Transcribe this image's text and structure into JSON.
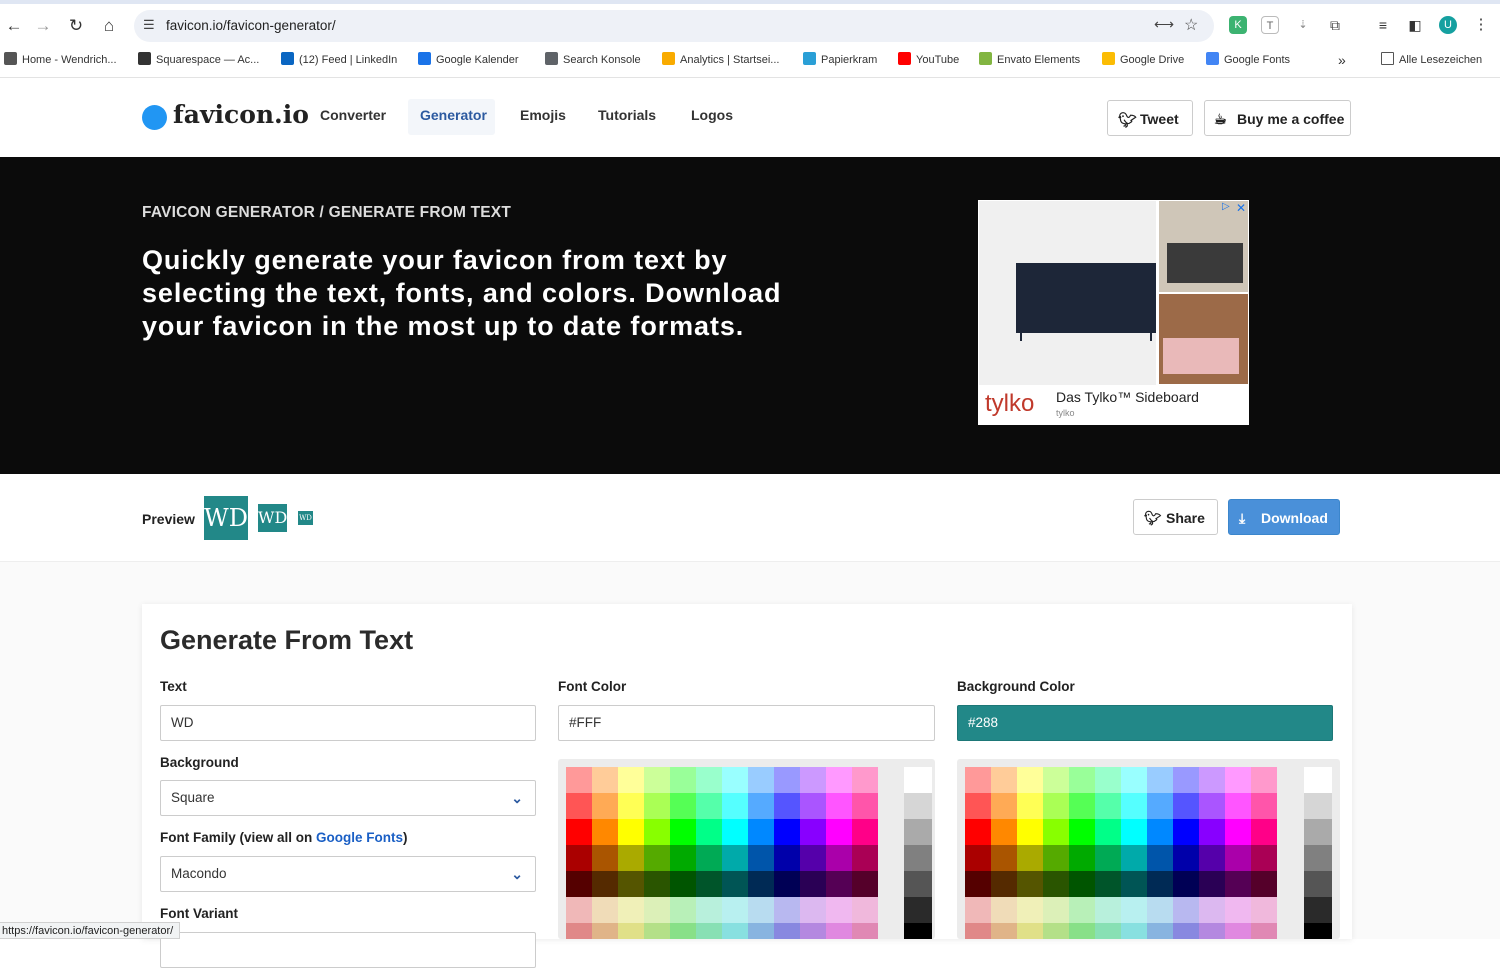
{
  "browser": {
    "url": "favicon.io/favicon-generator/",
    "status_url": "https://favicon.io/favicon-generator/",
    "bookmarks": [
      {
        "label": "Home - Wendrich...",
        "icon": "wd-icon",
        "color": "#555555"
      },
      {
        "label": "Squarespace — Ac...",
        "icon": "squarespace-icon",
        "color": "#333333"
      },
      {
        "label": "(12) Feed | LinkedIn",
        "icon": "linkedin-icon",
        "color": "#0a66c2"
      },
      {
        "label": "Google Kalender",
        "icon": "calendar-icon",
        "color": "#1a73e8"
      },
      {
        "label": "Search Konsole",
        "icon": "search-console-icon",
        "color": "#5f6368"
      },
      {
        "label": "Analytics | Startsei...",
        "icon": "analytics-icon",
        "color": "#f9ab00"
      },
      {
        "label": "Papierkram",
        "icon": "papierkram-icon",
        "color": "#2a9fd6"
      },
      {
        "label": "YouTube",
        "icon": "youtube-icon",
        "color": "#ff0000"
      },
      {
        "label": "Envato Elements",
        "icon": "envato-icon",
        "color": "#82b541"
      },
      {
        "label": "Google Drive",
        "icon": "drive-icon",
        "color": "#fbbc04"
      },
      {
        "label": "Google Fonts",
        "icon": "google-fonts-icon",
        "color": "#4285f4"
      }
    ],
    "bookmarks_overflow": "»",
    "all_bookmarks": "Alle Lesezeichen",
    "profile_initial": "U"
  },
  "header": {
    "logo": "favicon.io",
    "nav": [
      "Converter",
      "Generator",
      "Emojis",
      "Tutorials",
      "Logos"
    ],
    "active_nav": "Generator",
    "tweet_label": "Tweet",
    "coffee_label": "Buy me a coffee"
  },
  "hero": {
    "eyebrow": "FAVICON GENERATOR / GENERATE FROM TEXT",
    "title": "Quickly generate your favicon from text by selecting the text, fonts, and colors. Download your favicon in the most up to date formats."
  },
  "ad": {
    "brand": "tylko",
    "title": "Das Tylko™ Sideboard",
    "subtitle": "tylko"
  },
  "preview": {
    "label": "Preview",
    "favicon_text": "WD",
    "share_label": "Share",
    "download_label": "Download",
    "bg_color": "#228888"
  },
  "form": {
    "title": "Generate From Text",
    "text_label": "Text",
    "text_value": "WD",
    "background_label": "Background",
    "background_value": "Square",
    "font_family_label_prefix": "Font Family (view all on ",
    "font_family_link": "Google Fonts",
    "font_family_label_suffix": ")",
    "font_family_value": "Macondo",
    "font_variant_label": "Font Variant",
    "font_color_label": "Font Color",
    "font_color_value": "#FFF",
    "bg_color_label": "Background Color",
    "bg_color_value": "#288",
    "accent_color": "#228888"
  },
  "palette": {
    "rows": [
      [
        "#ff9999",
        "#ffcc99",
        "#ffff99",
        "#ccff99",
        "#99ff99",
        "#99ffcc",
        "#99ffff",
        "#99ccff",
        "#9999ff",
        "#cc99ff",
        "#ff99ff",
        "#ff99cc"
      ],
      [
        "#ff5555",
        "#ffaa55",
        "#ffff55",
        "#aaff55",
        "#55ff55",
        "#55ffaa",
        "#55ffff",
        "#55aaff",
        "#5555ff",
        "#aa55ff",
        "#ff55ff",
        "#ff55aa"
      ],
      [
        "#ff0000",
        "#ff8800",
        "#ffff00",
        "#88ff00",
        "#00ff00",
        "#00ff88",
        "#00ffff",
        "#0088ff",
        "#0000ff",
        "#8800ff",
        "#ff00ff",
        "#ff0088"
      ],
      [
        "#aa0000",
        "#aa5500",
        "#aaaa00",
        "#55aa00",
        "#00aa00",
        "#00aa55",
        "#00aaaa",
        "#0055aa",
        "#0000aa",
        "#5500aa",
        "#aa00aa",
        "#aa0055"
      ],
      [
        "#550000",
        "#552a00",
        "#555500",
        "#2a5500",
        "#005500",
        "#00552a",
        "#005555",
        "#002a55",
        "#000055",
        "#2a0055",
        "#550055",
        "#55002a"
      ],
      [
        "#f0b8b8",
        "#f0dcb8",
        "#f0f0b8",
        "#dcf0b8",
        "#b8f0b8",
        "#b8f0dc",
        "#b8f0f0",
        "#b8dcf0",
        "#b8b8f0",
        "#dcb8f0",
        "#f0b8f0",
        "#f0b8dc"
      ],
      [
        "#e08888",
        "#e0b488",
        "#e0e088",
        "#b4e088",
        "#88e088",
        "#88e0b4",
        "#88e0e0",
        "#88b4e0",
        "#8888e0",
        "#b488e0",
        "#e088e0",
        "#e088b4"
      ]
    ],
    "greys": [
      "#ffffff",
      "#d6d6d6",
      "#aaaaaa",
      "#808080",
      "#555555",
      "#2a2a2a",
      "#000000"
    ]
  }
}
